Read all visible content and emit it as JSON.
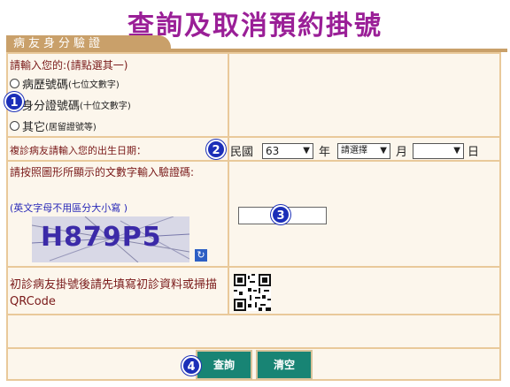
{
  "page_title": "查詢及取消預約掛號",
  "section_tab": "病友身分驗證",
  "id_section": {
    "prompt": "請輸入您的:(請點選其一)",
    "options": [
      {
        "label": "病歷號碼",
        "hint": "(七位文數字)"
      },
      {
        "label": "身分證號碼",
        "hint": "(十位文數字)"
      },
      {
        "label": "其它",
        "hint": "(居留證號等)"
      }
    ]
  },
  "birth_section": {
    "prompt": "複診病友請輸入您的出生日期：",
    "era_label": "民國",
    "year_value": "63",
    "year_unit": "年",
    "month_value": "請選擇",
    "month_unit": "月",
    "day_value": "",
    "day_unit": "日"
  },
  "captcha_section": {
    "prompt": "請按照圖形所顯示的文數字輸入驗證碼:",
    "note": "(英文字母不用區分大小寫 )",
    "captcha_text": "H879P5",
    "input_value": ""
  },
  "first_visit": {
    "text": "初診病友掛號後請先填寫初診資料或掃描QRCode"
  },
  "buttons": {
    "query": "查詢",
    "clear": "清空"
  },
  "badges": [
    "1",
    "2",
    "3",
    "4"
  ],
  "colors": {
    "title": "#9a1f97",
    "tab": "#c9a06a",
    "button": "#188474",
    "badge": "#1b2fb8"
  }
}
